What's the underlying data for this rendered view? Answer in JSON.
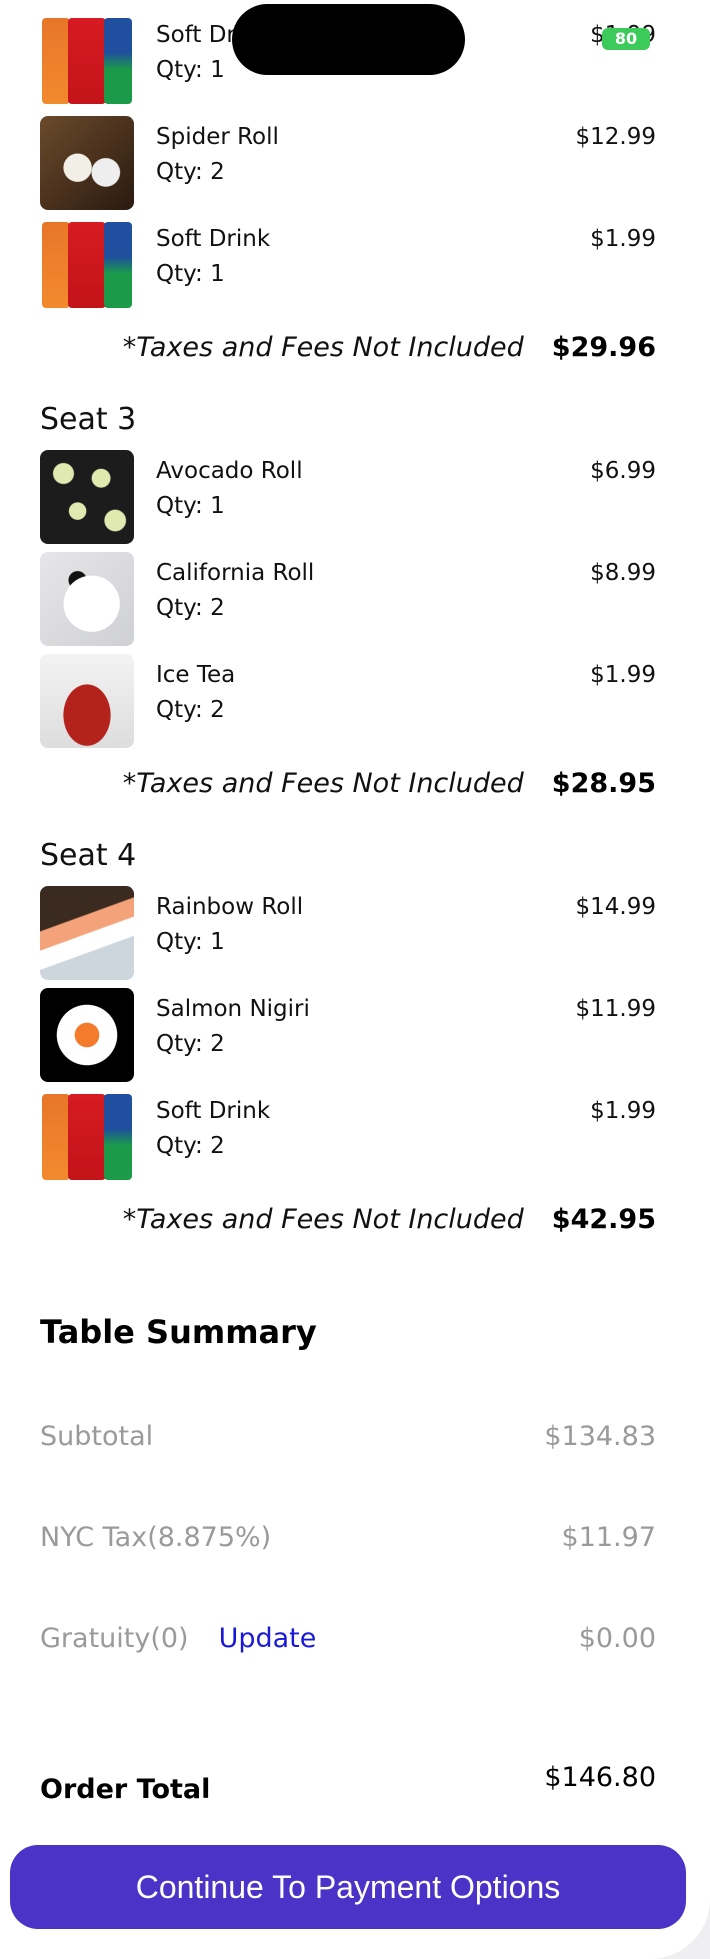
{
  "seats": [
    {
      "label": "",
      "items": [
        {
          "name": "Soft Drink",
          "qty": "Qty: 1",
          "price": "$1.99",
          "image": "cans"
        },
        {
          "name": "Spider Roll",
          "qty": "Qty: 2",
          "price": "$12.99",
          "image": "spider"
        },
        {
          "name": "Soft Drink",
          "qty": "Qty: 1",
          "price": "$1.99",
          "image": "cans"
        }
      ],
      "note": "*Taxes and Fees Not Included",
      "subtotal": "$29.96"
    },
    {
      "label": "Seat 3",
      "items": [
        {
          "name": "Avocado Roll",
          "qty": "Qty: 1",
          "price": "$6.99",
          "image": "avocado"
        },
        {
          "name": "California Roll",
          "qty": "Qty: 2",
          "price": "$8.99",
          "image": "california"
        },
        {
          "name": "Ice Tea",
          "qty": "Qty: 2",
          "price": "$1.99",
          "image": "icetea"
        }
      ],
      "note": "*Taxes and Fees Not Included",
      "subtotal": "$28.95"
    },
    {
      "label": "Seat 4",
      "items": [
        {
          "name": "Rainbow Roll",
          "qty": "Qty: 1",
          "price": "$14.99",
          "image": "rainbow"
        },
        {
          "name": "Salmon Nigiri",
          "qty": "Qty: 2",
          "price": "$11.99",
          "image": "nigiri"
        },
        {
          "name": "Soft Drink",
          "qty": "Qty: 2",
          "price": "$1.99",
          "image": "cans"
        }
      ],
      "note": "*Taxes and Fees Not Included",
      "subtotal": "$42.95"
    }
  ],
  "summary": {
    "title": "Table Summary",
    "subtotal_label": "Subtotal",
    "subtotal": "$134.83",
    "tax_label": "NYC Tax(8.875%)",
    "tax": "$11.97",
    "gratuity_label": "Gratuity(0)",
    "gratuity_update": "Update",
    "gratuity": "$0.00",
    "total_label": "Order Total",
    "total": "$146.80"
  },
  "button": {
    "label": "Continue To Payment Options",
    "color": "#4a33c6"
  },
  "status": {
    "battery": "80"
  }
}
